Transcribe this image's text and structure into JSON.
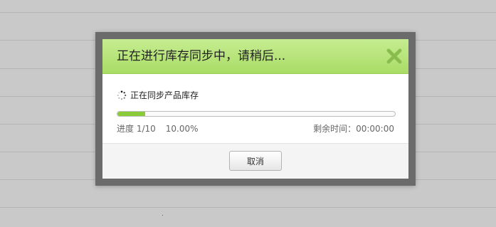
{
  "dialog": {
    "title": "正在进行库存同步中，请稍后...",
    "close_icon": "close-x-icon",
    "accent_color": "#a9dc66",
    "status_icon": "loading-spinner-icon",
    "status_text": "正在同步产品库存",
    "progress": {
      "fraction": 0.1,
      "label": "进度 1/10",
      "percent_text": "10.00%",
      "remaining_label": "剩余时间：",
      "remaining_value": "00:00:00",
      "fill_color": "#8bcb3a"
    },
    "cancel_label": "取消"
  }
}
